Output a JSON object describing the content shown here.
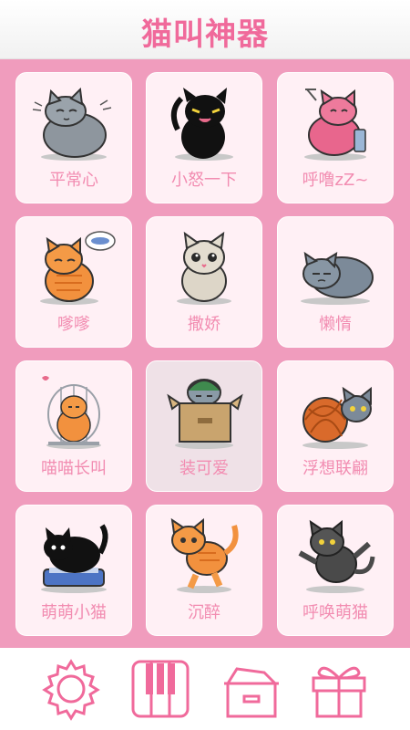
{
  "header": {
    "title": "猫叫神器"
  },
  "cards": [
    {
      "label": "平常心"
    },
    {
      "label": "小怒一下"
    },
    {
      "label": "呼噜zZ~"
    },
    {
      "label": "嗲嗲"
    },
    {
      "label": "撒娇"
    },
    {
      "label": "懒惰"
    },
    {
      "label": "喵喵长叫"
    },
    {
      "label": "装可爱"
    },
    {
      "label": "浮想联翩"
    },
    {
      "label": "萌萌小猫"
    },
    {
      "label": "沉醉"
    },
    {
      "label": "呼唤萌猫"
    }
  ],
  "colors": {
    "accent": "#f06a9b",
    "background": "#f09cbd",
    "card": "#fff0f5",
    "label": "#f28cb1"
  },
  "nav_icons": [
    "gear-icon",
    "piano-icon",
    "box-icon",
    "gift-icon"
  ]
}
